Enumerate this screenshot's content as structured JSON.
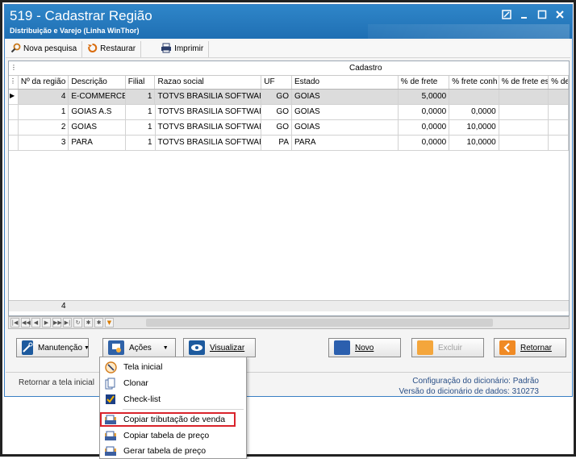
{
  "window": {
    "title": "519 - Cadastrar Região",
    "subtitle": "Distribuição e Varejo (Linha WinThor)",
    "controls": [
      "minimize",
      "maximize",
      "close"
    ]
  },
  "toolbar": {
    "new_search": "Nova pesquisa",
    "restore": "Restaurar",
    "print": "Imprimir"
  },
  "grid": {
    "band_label": "Cadastro",
    "columns": [
      "Nº da região",
      "Descrição",
      "Filial",
      "Razao social",
      "UF",
      "Estado",
      "% de frete",
      "% frete conh",
      "% de frete es",
      "% de"
    ],
    "rows": [
      {
        "id": "4",
        "desc": "E-COMMERCE",
        "filial": "1",
        "razao": "TOTVS BRASILIA SOFTWARE -",
        "uf": "GO",
        "estado": "GOIAS",
        "frete": "5,0000",
        "frete_conh": "",
        "frete_es": "",
        "extra": ""
      },
      {
        "id": "1",
        "desc": "GOIAS A.S",
        "filial": "1",
        "razao": "TOTVS BRASILIA SOFTWARE -",
        "uf": "GO",
        "estado": "GOIAS",
        "frete": "0,0000",
        "frete_conh": "0,0000",
        "frete_es": "",
        "extra": ""
      },
      {
        "id": "2",
        "desc": "GOIAS",
        "filial": "1",
        "razao": "TOTVS BRASILIA SOFTWARE -",
        "uf": "GO",
        "estado": "GOIAS",
        "frete": "0,0000",
        "frete_conh": "10,0000",
        "frete_es": "",
        "extra": ""
      },
      {
        "id": "3",
        "desc": "PARA",
        "filial": "1",
        "razao": "TOTVS BRASILIA SOFTWARE -",
        "uf": "PA",
        "estado": "PARA",
        "frete": "0,0000",
        "frete_conh": "10,0000",
        "frete_es": "",
        "extra": ""
      }
    ],
    "record_count": "4"
  },
  "buttons": {
    "manutencao": "Manutenção",
    "acoes": "Ações",
    "visualizar": "Visualizar",
    "novo": "Novo",
    "excluir": "Excluir",
    "retornar": "Retornar"
  },
  "status": {
    "left": "Retornar a tela inicial",
    "config_label": "Configuração do dicionário:",
    "config_value": "Padrão",
    "version_label": "Versão do dicionário de dados:",
    "version_value": "310273"
  },
  "menu": {
    "items": [
      {
        "label": "Tela inicial",
        "icon": "home-circle-icon"
      },
      {
        "label": "Clonar",
        "icon": "clone-icon"
      },
      {
        "label": "Check-list",
        "icon": "checkbox-icon"
      },
      {
        "label": "Copiar tributação de venda",
        "icon": "folder-copy-icon"
      },
      {
        "label": "Copiar tabela de preço",
        "icon": "folder-copy-icon"
      },
      {
        "label": "Gerar tabela de preço",
        "icon": "folder-generate-icon"
      }
    ],
    "highlight_color": "#d9232b"
  },
  "colors": {
    "titlebar": "#1f6fb3",
    "status_text": "#2a4f86"
  }
}
